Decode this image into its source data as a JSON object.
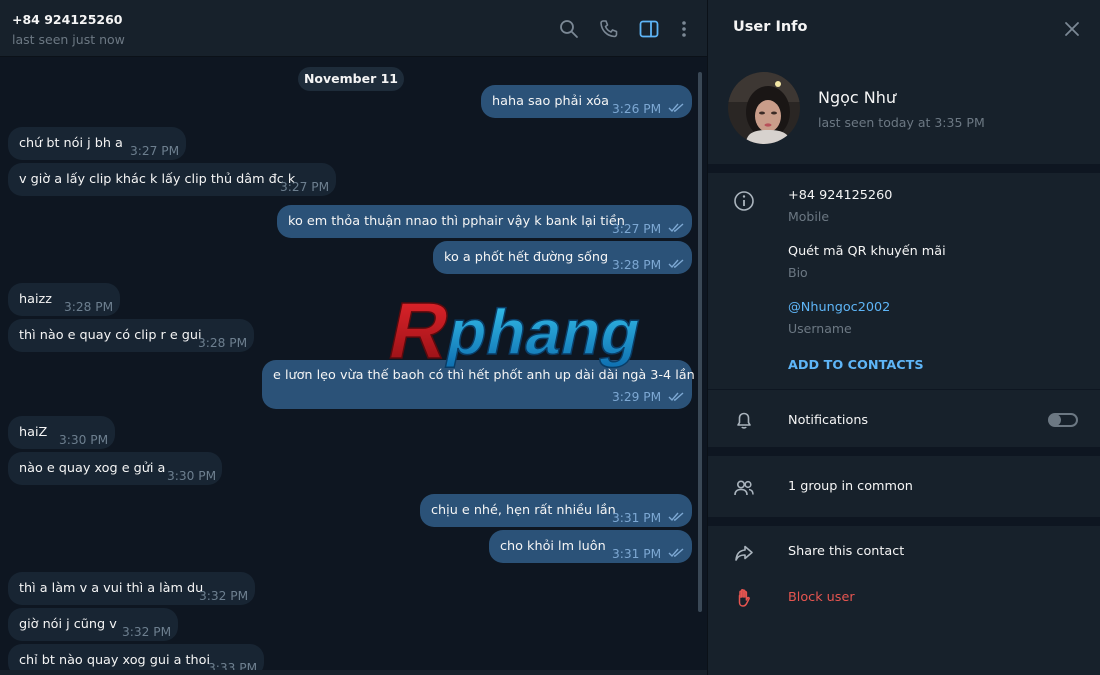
{
  "chat": {
    "title": "+84 924125260",
    "status": "last seen just now",
    "date_label": "November 11",
    "messages": [
      {
        "dir": "out",
        "text": "haha sao phải xóa",
        "time": "3:26 PM"
      },
      {
        "dir": "in",
        "text": "chứ bt nói j bh a",
        "time": "3:27 PM"
      },
      {
        "dir": "in",
        "text": "v giờ a lấy clip khác k lấy clip thủ dâm đc k",
        "time": "3:27 PM"
      },
      {
        "dir": "out",
        "text": "ko em thỏa thuận nnao thì pphair vậy k bank lại tiền",
        "time": "3:27 PM"
      },
      {
        "dir": "out",
        "text": "ko a phốt hết đường sống",
        "time": "3:28 PM"
      },
      {
        "dir": "in",
        "text": "haizz",
        "time": "3:28 PM"
      },
      {
        "dir": "in",
        "text": "thì nào e quay có clip r e gui",
        "time": "3:28 PM"
      },
      {
        "dir": "out",
        "text": "e lươn lẹo vừa thế baoh có thì hết phốt anh up dài dài ngà 3-4 lần",
        "time": "3:29 PM"
      },
      {
        "dir": "in",
        "text": "haiZ",
        "time": "3:30 PM"
      },
      {
        "dir": "in",
        "text": "nào e quay xog e gửi a",
        "time": "3:30 PM"
      },
      {
        "dir": "out",
        "text": "chịu e nhé, hẹn rất nhiều lần",
        "time": "3:31 PM"
      },
      {
        "dir": "out",
        "text": "cho khỏi lm luôn",
        "time": "3:31 PM"
      },
      {
        "dir": "in",
        "text": "thì a làm v a vui thì a làm du",
        "time": "3:32 PM"
      },
      {
        "dir": "in",
        "text": "giờ nói j cũng v",
        "time": "3:32 PM"
      },
      {
        "dir": "in",
        "text": "chỉ bt nào quay xog gui a thoi",
        "time": "3:33 PM"
      }
    ]
  },
  "watermark": {
    "text": "Rphang"
  },
  "panel": {
    "title": "User Info",
    "name": "Ngọc Như",
    "last_seen": "last seen today at 3:35 PM",
    "phone": "+84 924125260",
    "phone_label": "Mobile",
    "bio": "Quét mã QR khuyến mãi",
    "bio_label": "Bio",
    "username": "@Nhungoc2002",
    "username_label": "Username",
    "add_contacts": "ADD TO CONTACTS",
    "notifications": "Notifications",
    "groups": "1 group in common",
    "share": "Share this contact",
    "block": "Block user"
  },
  "colors": {
    "bg": "#0e1621",
    "panel": "#17212b",
    "bubble_in": "#182533",
    "bubble_out": "#2b5278",
    "accent": "#5eb5f7",
    "danger": "#e65550"
  }
}
